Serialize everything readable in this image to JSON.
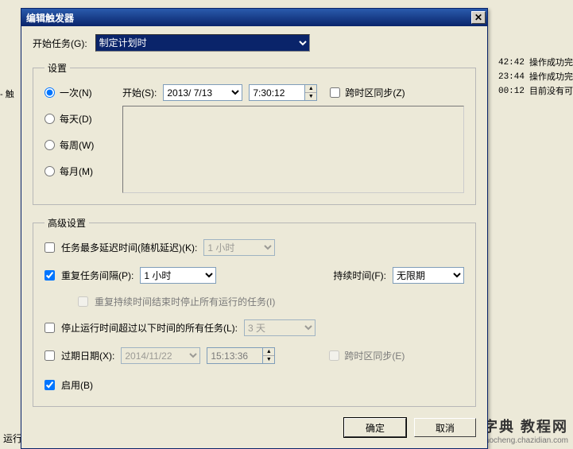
{
  "bg": {
    "left_tab": "- 触",
    "rows": [
      {
        "time": "42:42",
        "msg": "操作成功完"
      },
      {
        "time": "23:44",
        "msg": "操作成功完"
      },
      {
        "time": "00:12",
        "msg": "目前没有可"
      }
    ],
    "footer": "运行",
    "wm_big": "查字典 教程网",
    "wm_small": "jiaocheng.chazidian.com"
  },
  "dlg": {
    "title": "编辑触发器",
    "begin_task_label": "开始任务(G):",
    "begin_task_value": "制定计划时",
    "settings_legend": "设置",
    "radios": {
      "once": "一次(N)",
      "daily": "每天(D)",
      "weekly": "每周(W)",
      "monthly": "每月(M)"
    },
    "start_label": "开始(S):",
    "start_date": "2013/ 7/13",
    "start_time": "7:30:12",
    "sync_tz": "跨时区同步(Z)",
    "adv_legend": "高级设置",
    "random_delay_label": "任务最多延迟时间(随机延迟)(K):",
    "random_delay_value": "1 小时",
    "repeat_label": "重复任务间隔(P):",
    "repeat_value": "1 小时",
    "duration_label": "持续时间(F):",
    "duration_value": "无限期",
    "stop_at_end_label": "重复持续时间结束时停止所有运行的任务(I)",
    "stop_longer_label": "停止运行时间超过以下时间的所有任务(L):",
    "stop_longer_value": "3 天",
    "expire_label": "过期日期(X):",
    "expire_date": "2014/11/22",
    "expire_time": "15:13:36",
    "expire_sync": "跨时区同步(E)",
    "enabled_label": "启用(B)",
    "ok": "确定",
    "cancel": "取消"
  }
}
